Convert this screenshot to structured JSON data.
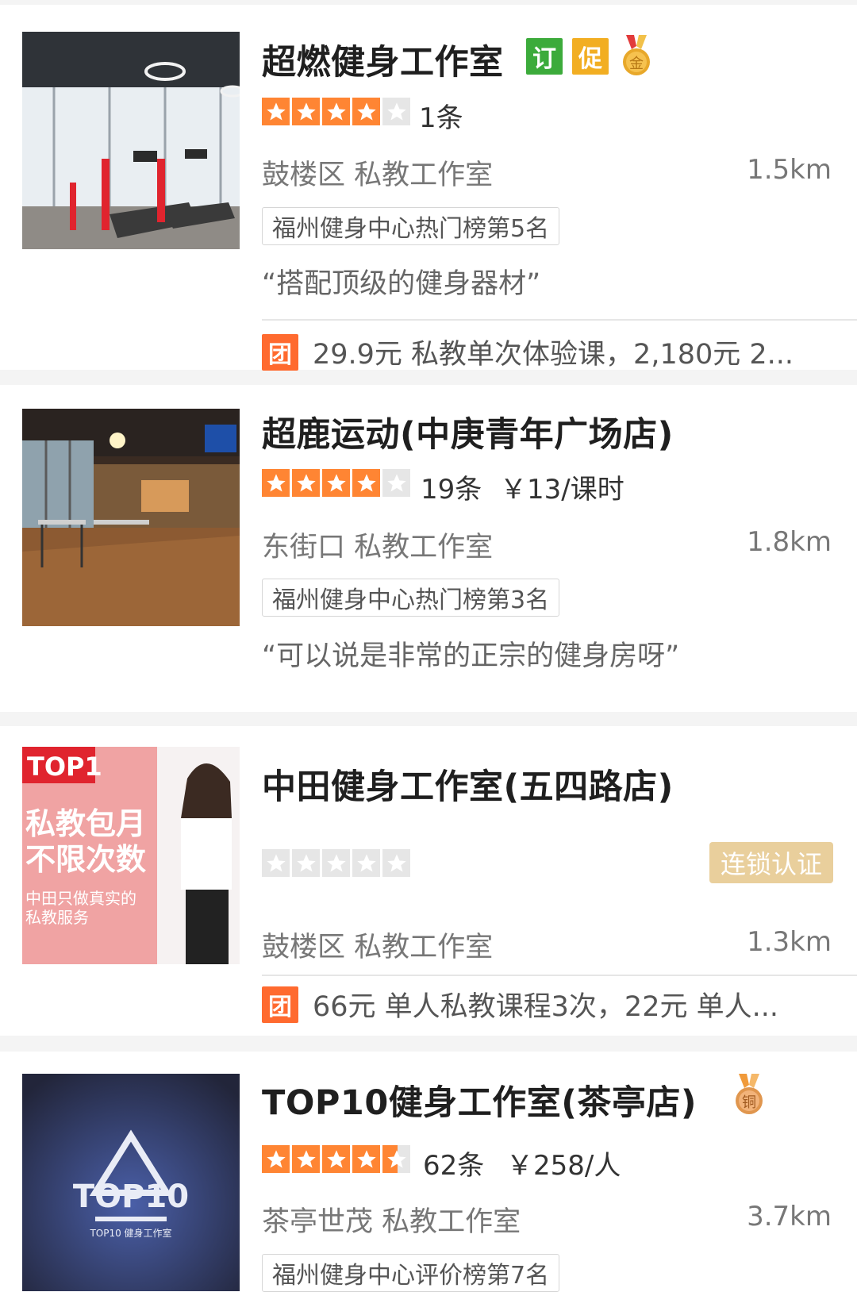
{
  "listings": [
    {
      "title": "超燃健身工作室",
      "tags": [
        {
          "text": "订",
          "color": "#3cab3b"
        },
        {
          "text": "促",
          "color": "#f2ae22"
        }
      ],
      "medal": {
        "text": "金",
        "icon": "gold-medal-icon",
        "color": "#e4a524"
      },
      "rating_stars": 4,
      "reviews": "1条",
      "price": "",
      "location": "鼓楼区 私教工作室",
      "distance": "1.5km",
      "rank_badge": "福州健身中心热门榜第5名",
      "quote": "“搭配顶级的健身器材”",
      "deal_icon": "团",
      "deal_text": "29.9元 私教单次体验课，2,180元 2..."
    },
    {
      "title": "超鹿运动(中庚青年广场店)",
      "rating_stars": 4,
      "reviews": "19条",
      "price": "￥13/课时",
      "location": "东街口 私教工作室",
      "distance": "1.8km",
      "rank_badge": "福州健身中心热门榜第3名",
      "quote": "“可以说是非常的正宗的健身房呀”"
    },
    {
      "title": "中田健身工作室(五四路店)",
      "rating_stars": 0,
      "chain_badge": "连锁认证",
      "location": "鼓楼区 私教工作室",
      "distance": "1.3km",
      "deal_icon": "团",
      "deal_text": "66元 单人私教课程3次，22元 单人...",
      "thumb_text": {
        "top": "TOP1",
        "line1": "私教包月",
        "line2": "不限次数",
        "line3": "中田只做真实的",
        "line4": "私教服务"
      }
    },
    {
      "title": "TOP10健身工作室(茶亭店)",
      "medal": {
        "text": "铜",
        "icon": "bronze-medal-icon",
        "color": "#e2a15a"
      },
      "rating_stars": 4.5,
      "reviews": "62条",
      "price": "￥258/人",
      "location": "茶亭世茂 私教工作室",
      "distance": "3.7km",
      "rank_badge": "福州健身中心评价榜第7名",
      "thumb_text": {
        "logo": "TOP10",
        "sub": "TOP10 健身工作室"
      }
    }
  ],
  "colors": {
    "star_on": "#ff8533",
    "star_off": "#e6e6e6",
    "deal": "#ff6a2f",
    "chain": "#e9cf9c"
  }
}
